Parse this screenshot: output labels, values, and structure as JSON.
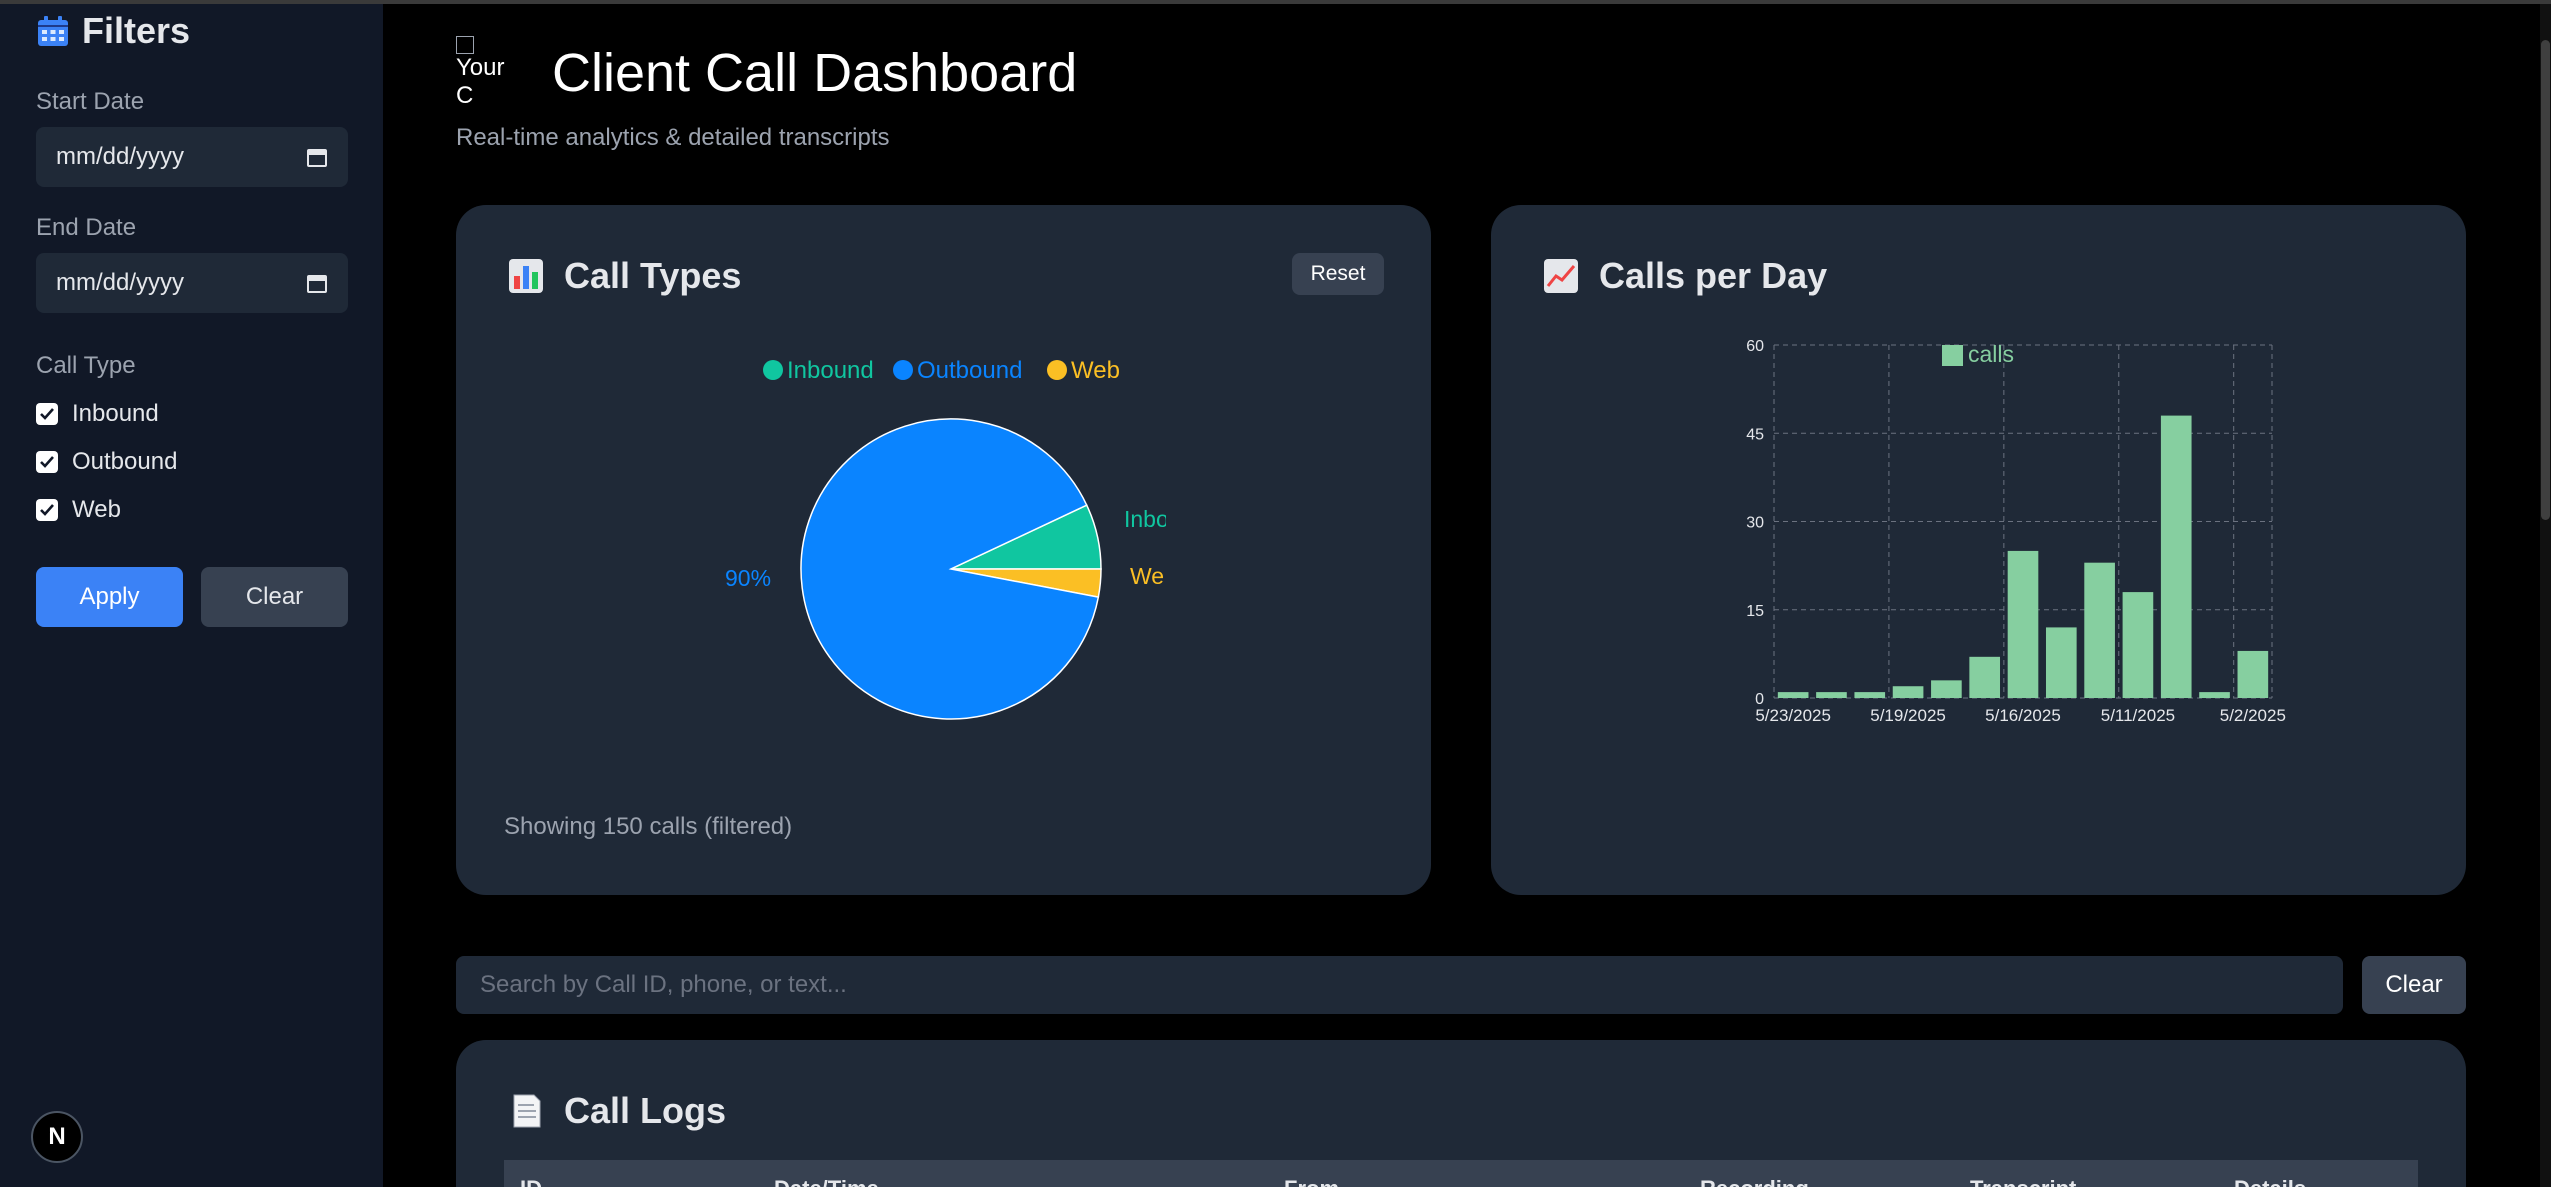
{
  "sidebar": {
    "title": "Filters",
    "start_label": "Start Date",
    "start_value": "mm/dd/yyyy",
    "end_label": "End Date",
    "end_value": "mm/dd/yyyy",
    "call_type_label": "Call Type",
    "types": [
      {
        "label": "Inbound",
        "checked": true
      },
      {
        "label": "Outbound",
        "checked": true
      },
      {
        "label": "Web",
        "checked": true
      }
    ],
    "apply": "Apply",
    "clear": "Clear",
    "badge": "N"
  },
  "header": {
    "logo_alt": "Your C",
    "title": "Client Call Dashboard",
    "subtitle": "Real-time analytics & detailed transcripts"
  },
  "pie_card": {
    "title": "Call Types",
    "reset": "Reset",
    "showing": "Showing 150 calls (filtered)"
  },
  "bar_card": {
    "title": "Calls per Day"
  },
  "search": {
    "placeholder": "Search by Call ID, phone, or text...",
    "clear": "Clear"
  },
  "logs": {
    "title": "Call Logs",
    "headers": [
      "ID",
      "Date/Time",
      "From",
      "Recording",
      "Transcript",
      "Details"
    ]
  },
  "colors": {
    "inbound": "#10c6a0",
    "outbound": "#0a84ff",
    "web": "#fbbf24",
    "bars": "#86cfa0"
  },
  "chart_data": [
    {
      "type": "pie",
      "categories": [
        "Inbound",
        "Outbound",
        "Web"
      ],
      "values": [
        7,
        90,
        3
      ],
      "legend": "top",
      "labels_visible": [
        "Inbo",
        "90%",
        "We"
      ]
    },
    {
      "type": "bar",
      "categories": [
        "5/23/2025",
        "",
        "",
        "5/19/2025",
        "",
        "",
        "5/16/2025",
        "",
        "",
        "5/11/2025",
        "",
        "",
        "5/2/2025"
      ],
      "values": [
        1,
        1,
        1,
        2,
        3,
        7,
        25,
        12,
        23,
        18,
        48,
        1,
        8
      ],
      "series": [
        {
          "name": "calls"
        }
      ],
      "ylim": [
        0,
        60
      ],
      "yticks": [
        0,
        15,
        30,
        45,
        60
      ],
      "grid": true,
      "legend": "top"
    }
  ]
}
